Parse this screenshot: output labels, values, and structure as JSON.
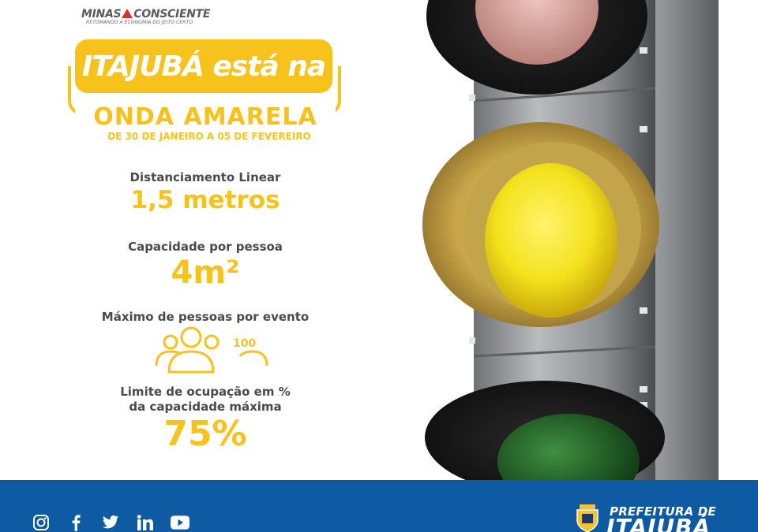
{
  "logo": {
    "name_left": "MINAS",
    "name_right": "CONSCIENTE",
    "tagline": "RETOMANDO A ECONOMIA DO JEITO CERTO",
    "triangle_color": "#d6312c"
  },
  "headline": {
    "banner": "ITAJUBÁ está na",
    "wave": "ONDA AMARELA",
    "dates": "DE 30 DE JANEIRO A 05 DE FEVEREIRO"
  },
  "rules": [
    {
      "label": "Distanciamento Linear",
      "value": "1,5 metros"
    },
    {
      "label": "Capacidade por pessoa",
      "value": "4m²"
    },
    {
      "label": "Máximo de pessoas por evento",
      "value": "100",
      "icon": "people-group-icon"
    },
    {
      "label_line1": "Limite de ocupação em %",
      "label_line2": "da capacidade máxima",
      "value": "75%"
    }
  ],
  "traffic_light": {
    "active": "yellow",
    "lights": [
      "red",
      "yellow",
      "green"
    ]
  },
  "footer": {
    "social": [
      "instagram-icon",
      "facebook-icon",
      "twitter-icon",
      "linkedin-icon",
      "youtube-icon"
    ],
    "org_line1": "PREFEITURA DE",
    "org_line2": "ITAJUBÁ"
  },
  "colors": {
    "accent": "#f8c21d",
    "text": "#4a4a4a",
    "footer": "#0e5aa3"
  }
}
